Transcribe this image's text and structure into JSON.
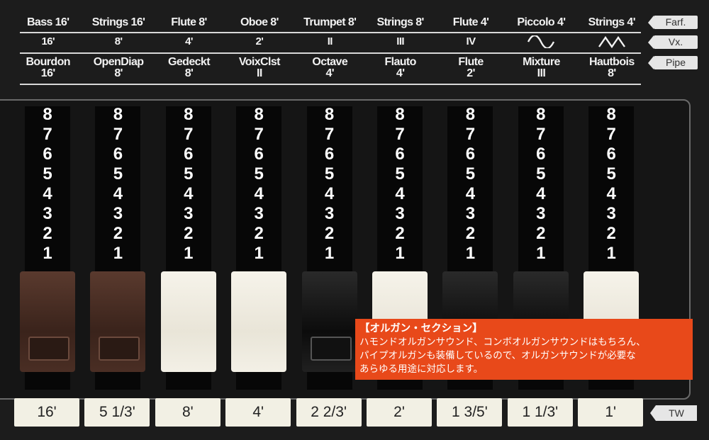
{
  "labels": {
    "top": [
      "Bass 16'",
      "Strings 16'",
      "Flute 8'",
      "Oboe 8'",
      "Trumpet 8'",
      "Strings 8'",
      "Flute 4'",
      "Piccolo 4'",
      "Strings 4'"
    ],
    "mid": [
      "16'",
      "8'",
      "4'",
      "2'",
      "II",
      "III",
      "IV",
      "",
      ""
    ],
    "mid_waves": [
      "",
      "",
      "",
      "",
      "",
      "",
      "",
      "sine-wave-icon",
      "triangle-wave-icon"
    ],
    "bottom": [
      [
        "Bourdon",
        "16'"
      ],
      [
        "OpenDiap",
        "8'"
      ],
      [
        "Gedeckt",
        "8'"
      ],
      [
        "VoixClst",
        "II"
      ],
      [
        "Octave",
        "4'"
      ],
      [
        "Flauto",
        "4'"
      ],
      [
        "Flute",
        "2'"
      ],
      [
        "Mixture",
        "III"
      ],
      [
        "Hautbois",
        "8'"
      ]
    ]
  },
  "modes": [
    "Farf.",
    "Vx.",
    "Pipe"
  ],
  "drawbar_numbers": [
    "8",
    "7",
    "6",
    "5",
    "4",
    "3",
    "2",
    "1"
  ],
  "drawbars": [
    {
      "color": "brown",
      "footage": "16'"
    },
    {
      "color": "brown",
      "footage": "5 1/3'"
    },
    {
      "color": "white",
      "footage": "8'"
    },
    {
      "color": "white",
      "footage": "4'"
    },
    {
      "color": "black",
      "footage": "2 2/3'"
    },
    {
      "color": "white",
      "footage": "2'"
    },
    {
      "color": "black",
      "footage": "1 3/5'"
    },
    {
      "color": "black",
      "footage": "1 1/3'"
    },
    {
      "color": "white",
      "footage": "1'"
    }
  ],
  "tw_label": "TW",
  "caption": {
    "title": "【オルガン・セクション】",
    "lines": [
      "ハモンドオルガンサウンド、コンボオルガンサウンドはもちろん、",
      "パイプオルガンも装備しているので、オルガンサウンドが必要な",
      "あらゆる用途に対応します。"
    ],
    "bg_color": "#e8491a"
  },
  "colors": {
    "brown": "#4a2e24",
    "white": "#efece1",
    "black": "#141414"
  }
}
